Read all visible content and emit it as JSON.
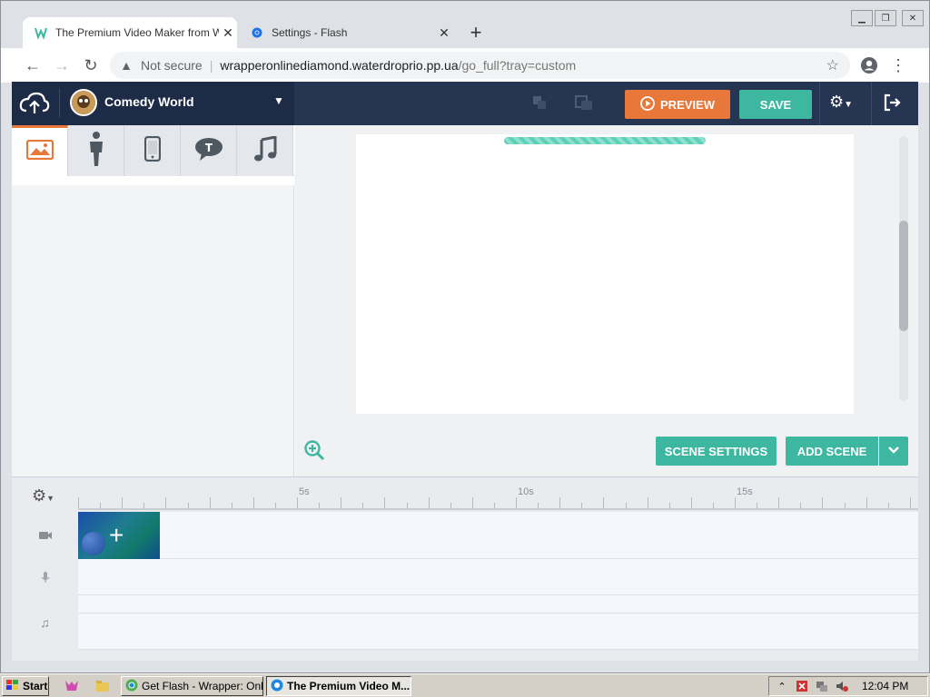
{
  "browser": {
    "tabs": [
      {
        "title": "The Premium Video Maker from Wr",
        "icon": "wrapper-favicon",
        "active": true
      },
      {
        "title": "Settings - Flash",
        "icon": "settings-gear-icon",
        "active": false
      }
    ],
    "new_tab": "+",
    "address": {
      "security": "Not secure",
      "host": "wrapperonlinediamond.waterdroprio.pp.ua",
      "path": "/go_full?tray=custom"
    }
  },
  "app": {
    "theme_name": "Comedy World",
    "preview_label": "PREVIEW",
    "save_label": "SAVE",
    "scene_settings_label": "SCENE SETTINGS",
    "add_scene_label": "ADD SCENE",
    "library_tabs": [
      "image-icon",
      "character-icon",
      "prop-icon",
      "text-icon",
      "music-icon"
    ],
    "timeline": {
      "ticks": [
        {
          "label": "5s"
        },
        {
          "label": "10s"
        },
        {
          "label": "15s"
        }
      ],
      "tracks": [
        "video-icon",
        "microphone-icon",
        "music-note-icon"
      ]
    },
    "colors": {
      "topbar": "#263552",
      "preview": "#e8773a",
      "accent": "#3db7a0"
    }
  },
  "taskbar": {
    "start_label": "Start",
    "tasks": [
      {
        "label": "Get Flash - Wrapper: Onl...",
        "active": false
      },
      {
        "label": "The Premium Video M...",
        "active": true
      }
    ],
    "clock": "12:04 PM"
  }
}
